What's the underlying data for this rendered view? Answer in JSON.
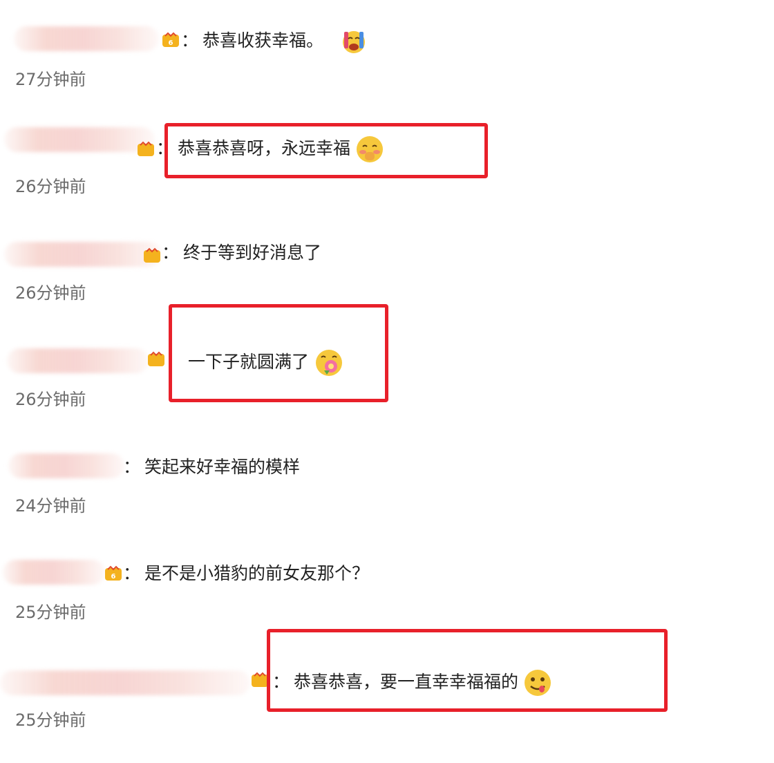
{
  "comments": [
    {
      "text": "恭喜收获幸福。",
      "time": "27分钟前",
      "emoji": "crying-face-icon"
    },
    {
      "text": "恭喜恭喜呀，永远幸福",
      "time": "26分钟前",
      "emoji": "blushing-face-icon"
    },
    {
      "text": "终于等到好消息了",
      "time": "26分钟前",
      "emoji": ""
    },
    {
      "text": "一下子就圆满了",
      "time": "26分钟前",
      "emoji": "flower-face-icon"
    },
    {
      "text": "笑起来好幸福的模样",
      "time": "24分钟前",
      "emoji": ""
    },
    {
      "text": "是不是小猎豹的前女友那个？",
      "time": "25分钟前",
      "emoji": ""
    },
    {
      "text": "恭喜恭喜，要一直幸幸福福的",
      "time": "25分钟前",
      "emoji": "yum-face-icon"
    }
  ],
  "separator": "：",
  "colors": {
    "highlight": "#e8202a",
    "text": "#222222",
    "timestamp": "#6b6b6b"
  }
}
